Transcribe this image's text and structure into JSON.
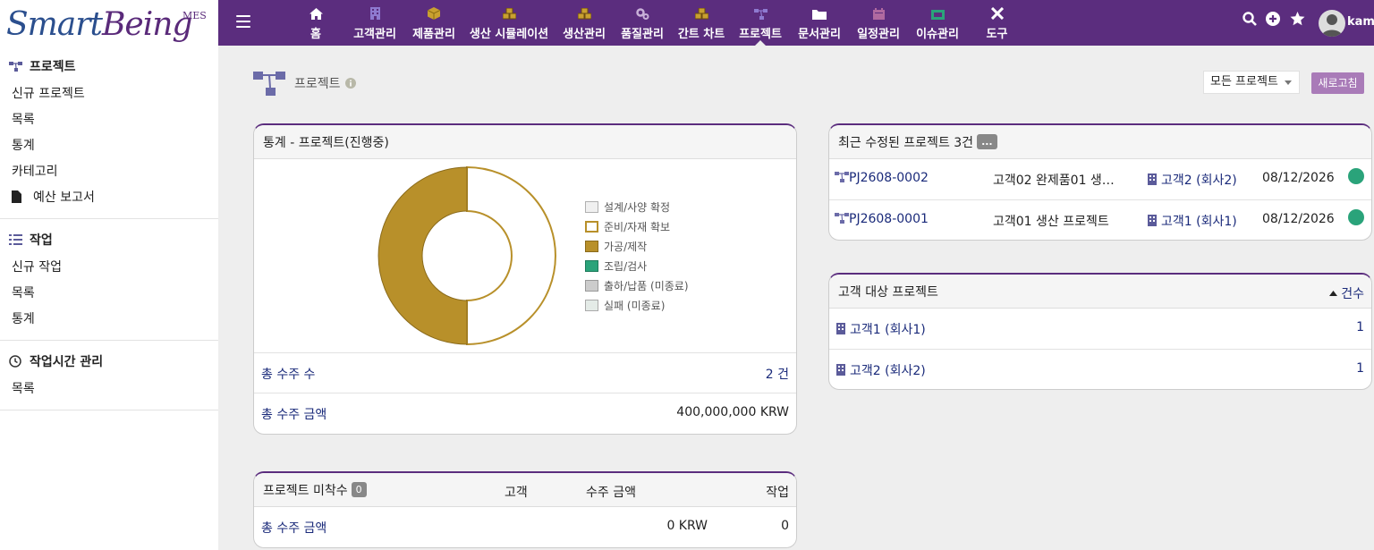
{
  "brand": {
    "name_a": "Smart",
    "name_b": "Being",
    "suffix": "MES"
  },
  "nav": [
    {
      "label": "홈",
      "icon": "home-icon"
    },
    {
      "label": "고객관리",
      "icon": "building-icon"
    },
    {
      "label": "제품관리",
      "icon": "cube-icon"
    },
    {
      "label": "생산 시뮬레이션",
      "icon": "cubes-icon"
    },
    {
      "label": "생산관리",
      "icon": "cubes-icon"
    },
    {
      "label": "품질관리",
      "icon": "cogs-icon"
    },
    {
      "label": "간트 차트",
      "icon": "cubes-icon"
    },
    {
      "label": "프로젝트",
      "icon": "sitemap-icon"
    },
    {
      "label": "문서관리",
      "icon": "folder-icon"
    },
    {
      "label": "일정관리",
      "icon": "calendar-icon"
    },
    {
      "label": "이슈관리",
      "icon": "ticket-icon"
    },
    {
      "label": "도구",
      "icon": "tools-icon"
    }
  ],
  "user": {
    "name": "kame"
  },
  "sidebar": {
    "sections": [
      {
        "title": "프로젝트",
        "items": [
          "신규 프로젝트",
          "목록",
          "통계",
          "카테고리",
          "예산 보고서"
        ]
      },
      {
        "title": "작업",
        "items": [
          "신규 작업",
          "목록",
          "통계"
        ]
      },
      {
        "title": "작업시간 관리",
        "items": [
          "목록"
        ]
      }
    ]
  },
  "page": {
    "title": "프로젝트",
    "filter": "모든 프로젝트",
    "refresh": "새로고침"
  },
  "stats": {
    "title": "통계 - 프로젝트(진행중)",
    "legend": [
      {
        "label": "설계/사양 확정",
        "color": "#f0f0f0",
        "border": "#b0b0b0"
      },
      {
        "label": "준비/자재 확보",
        "color": "#ffffff",
        "border": "#b8902a"
      },
      {
        "label": "가공/제작",
        "color": "#b8902a",
        "border": "#8a6a1a"
      },
      {
        "label": "조립/검사",
        "color": "#2aa37a",
        "border": "#1d7a5a"
      },
      {
        "label": "출하/납품 (미종료)",
        "color": "#cccccc",
        "border": "#999999"
      },
      {
        "label": "실패 (미종료)",
        "color": "#e4ebe7",
        "border": "#aaaaaa"
      }
    ],
    "chart_data": {
      "type": "pie",
      "categories": [
        "설계/사양 확정",
        "준비/자재 확보",
        "가공/제작",
        "조립/검사",
        "출하/납품 (미종료)",
        "실패 (미종료)"
      ],
      "values": [
        0,
        1,
        1,
        0,
        0,
        0
      ]
    },
    "total_count_label": "총 수주 수",
    "total_count_value": "2 건",
    "total_amount_label": "총 수주 금액",
    "total_amount_value": "400,000,000 KRW"
  },
  "unstarted": {
    "title": "프로젝트 미착수",
    "count": "0",
    "col_customer": "고객",
    "col_amount": "수주 금액",
    "col_task": "작업",
    "total_label": "총 수주 금액",
    "total_amount": "0 KRW",
    "total_task": "0"
  },
  "recent": {
    "title": "최근 수정된 프로젝트 3건",
    "more": "...",
    "rows": [
      {
        "ref": "PJ2608-0002",
        "label": "고객02 완제품01 생…",
        "customer": "고객2 (회사2)",
        "date": "08/12/2026",
        "status_color": "#2aa37a"
      },
      {
        "ref": "PJ2608-0001",
        "label": "고객01 생산 프로젝트",
        "customer": "고객1 (회사1)",
        "date": "08/12/2026",
        "status_color": "#2aa37a"
      }
    ]
  },
  "customers": {
    "title": "고객 대상 프로젝트",
    "sort_label": "건수",
    "rows": [
      {
        "name": "고객1 (회사1)",
        "count": "1"
      },
      {
        "name": "고객2 (회사2)",
        "count": "1"
      }
    ]
  }
}
